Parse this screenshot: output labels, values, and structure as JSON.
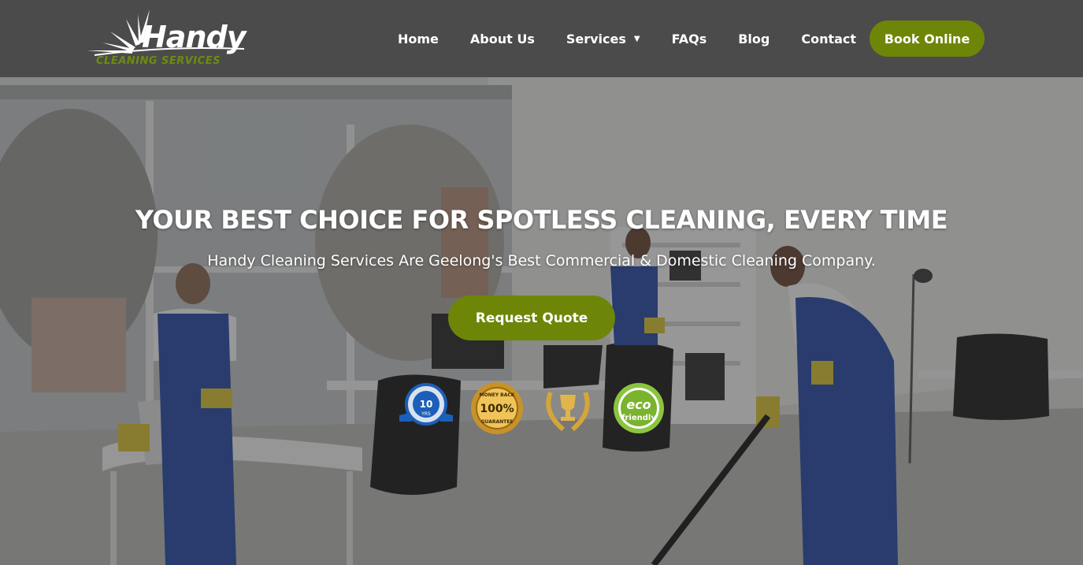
{
  "brand": {
    "name": "Handy",
    "tagline": "CLEANING SERVICES",
    "accent_color": "#6e8608"
  },
  "nav": {
    "items": [
      {
        "label": "Home"
      },
      {
        "label": "About Us"
      },
      {
        "label": "Services",
        "has_dropdown": true
      },
      {
        "label": "FAQs"
      },
      {
        "label": "Blog"
      },
      {
        "label": "Contact"
      }
    ],
    "cta_label": "Book Online"
  },
  "hero": {
    "title": "YOUR BEST CHOICE FOR SPOTLESS CLEANING, EVERY TIME",
    "subtitle": "Handy Cleaning Services Are Geelong's Best Commercial & Domestic Cleaning Company.",
    "cta_label": "Request Quote"
  },
  "badges": {
    "years": {
      "number": "10",
      "unit": "YRS"
    },
    "money_back": {
      "top": "MONEY BACK",
      "value": "100%",
      "bottom": "GUARANTEE"
    },
    "trophy": {
      "icon": "trophy-icon"
    },
    "eco": {
      "line1": "eco",
      "line2": "friendly"
    }
  }
}
